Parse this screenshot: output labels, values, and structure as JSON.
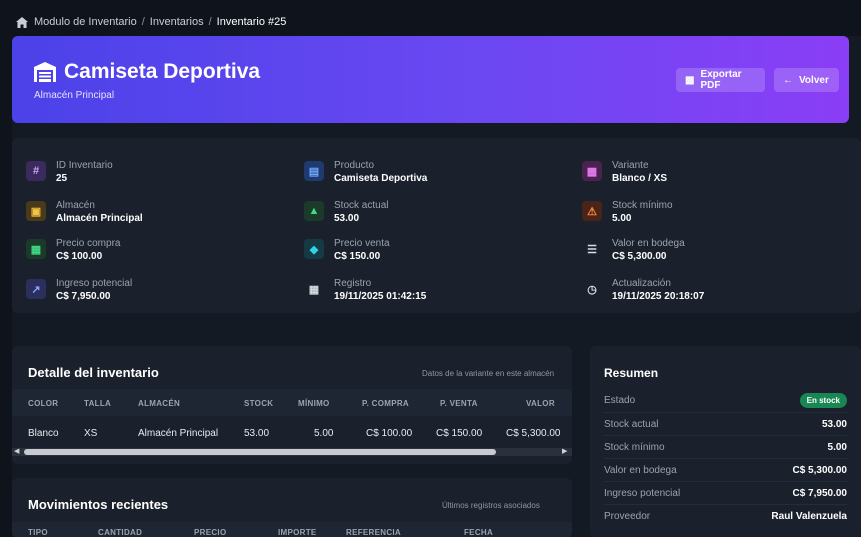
{
  "breadcrumb": {
    "items": [
      "Modulo de Inventario",
      "Inventarios",
      "Inventario #25"
    ]
  },
  "header": {
    "title": "Camiseta Deportiva",
    "subtitle": "Almacén Principal",
    "export_label": "Exportar PDF",
    "back_label": "Volver"
  },
  "info": [
    {
      "label": "ID Inventario",
      "value": "25",
      "icon": "hash-icon"
    },
    {
      "label": "Producto",
      "value": "Camiseta Deportiva",
      "icon": "box-icon"
    },
    {
      "label": "Variante",
      "value": "Blanco / XS",
      "icon": "variant-icon"
    },
    {
      "label": "Almacén",
      "value": "Almacén Principal",
      "icon": "warehouse-icon"
    },
    {
      "label": "Stock actual",
      "value": "53.00",
      "icon": "cubes-icon"
    },
    {
      "label": "Stock mínimo",
      "value": "5.00",
      "icon": "warning-icon"
    },
    {
      "label": "Precio compra",
      "value": "C$ 100.00",
      "icon": "money-icon"
    },
    {
      "label": "Precio venta",
      "value": "C$ 150.00",
      "icon": "tag-icon"
    },
    {
      "label": "Valor en bodega",
      "value": "C$ 5,300.00",
      "icon": "coins-icon"
    },
    {
      "label": "Ingreso potencial",
      "value": "C$ 7,950.00",
      "icon": "chart-line-icon"
    },
    {
      "label": "Registro",
      "value": "19/11/2025 01:42:15",
      "icon": "calendar-icon"
    },
    {
      "label": "Actualización",
      "value": "19/11/2025 20:18:07",
      "icon": "clock-icon"
    }
  ],
  "detail": {
    "title": "Detalle del inventario",
    "note": "Datos de la variante en este almacén",
    "columns": [
      "COLOR",
      "TALLA",
      "ALMACÉN",
      "STOCK",
      "MÍNIMO",
      "P. COMPRA",
      "P. VENTA",
      "VALOR"
    ],
    "row": [
      "Blanco",
      "XS",
      "Almacén Principal",
      "53.00",
      "5.00",
      "C$ 100.00",
      "C$ 150.00",
      "C$ 5,300.00"
    ],
    "scroll_left": "◀",
    "scroll_right": "▶"
  },
  "moves": {
    "title": "Movimientos recientes",
    "note": "Últimos registros asociados",
    "columns": [
      "TIPO",
      "CANTIDAD",
      "PRECIO",
      "IMPORTE",
      "REFERENCIA",
      "FECHA"
    ]
  },
  "summary": {
    "title": "Resumen",
    "status_label": "Estado",
    "status_badge": "En stock",
    "rows": [
      {
        "label": "Stock actual",
        "value": "53.00"
      },
      {
        "label": "Stock mínimo",
        "value": "5.00"
      },
      {
        "label": "Valor en bodega",
        "value": "C$ 5,300.00"
      },
      {
        "label": "Ingreso potencial",
        "value": "C$ 7,950.00"
      },
      {
        "label": "Proveedor",
        "value": "Raul Valenzuela"
      }
    ]
  },
  "colors": {
    "accent_from": "#4b42e8",
    "accent_to": "#8a3ef5",
    "badge_green": "#198754"
  }
}
